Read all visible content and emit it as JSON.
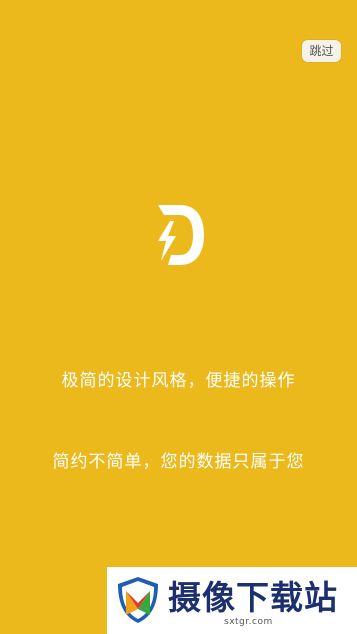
{
  "skip_button": {
    "label": "跳过"
  },
  "app_logo": {
    "icon": "lightning-d-logo-icon",
    "color": "#ffffff"
  },
  "slogans": {
    "line1": "极简的设计风格，便捷的操作",
    "line2": "简约不简单，您的数据只属于您"
  },
  "watermark": {
    "title": "摄像下载站",
    "url": "sxtgr.com",
    "icon": "shield-logo-icon"
  },
  "colors": {
    "background": "#ecb91c",
    "text": "#ffffff",
    "watermark_title": "#1c2f6e"
  }
}
